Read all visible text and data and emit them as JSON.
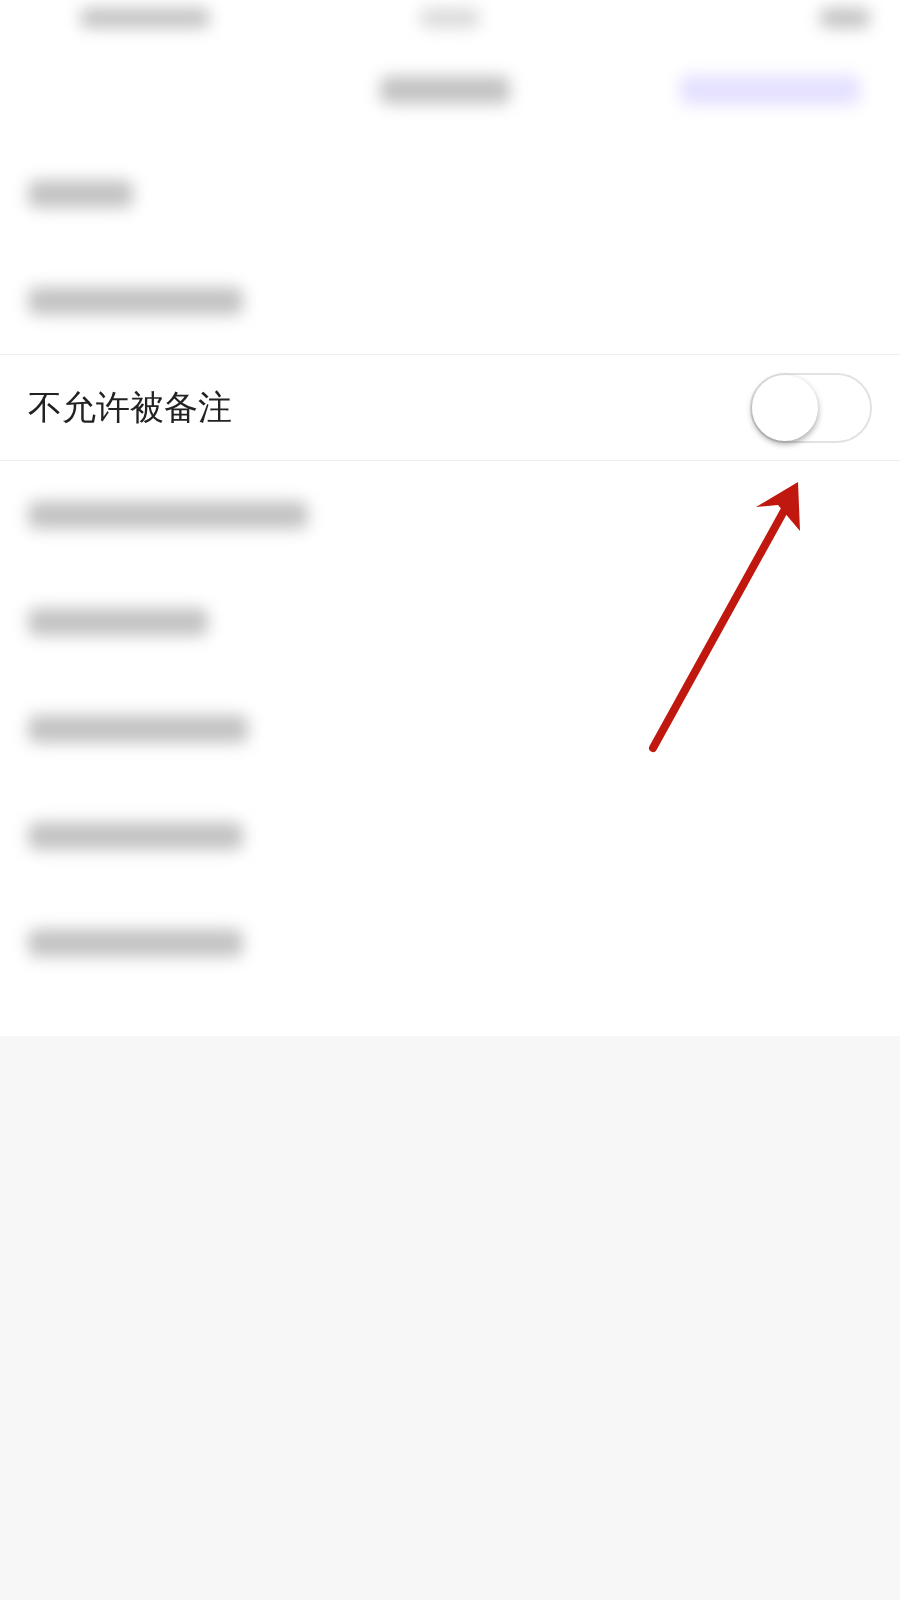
{
  "rows": [
    {
      "kind": "blurred"
    },
    {
      "kind": "blurred"
    },
    {
      "kind": "toggle",
      "label": "不允许被备注",
      "on": false
    },
    {
      "kind": "blurred"
    },
    {
      "kind": "blurred"
    },
    {
      "kind": "blurred"
    },
    {
      "kind": "blurred"
    },
    {
      "kind": "blurred"
    }
  ]
}
